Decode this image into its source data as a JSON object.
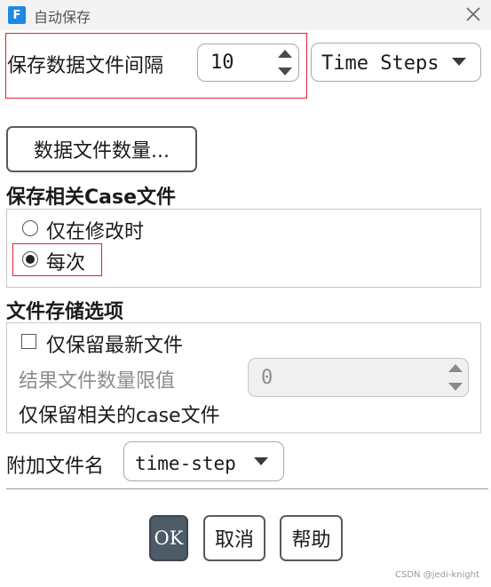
{
  "window": {
    "app_logo_letter": "F",
    "title": "自动保存"
  },
  "interval": {
    "label": "保存数据文件间隔",
    "value": "10",
    "unit_value": "Time Steps"
  },
  "data_file_count_button": "数据文件数量...",
  "case_group": {
    "label": "保存相关Case文件",
    "options": [
      {
        "label": "仅在修改时",
        "selected": false
      },
      {
        "label": "每次",
        "selected": true
      }
    ]
  },
  "storage_group": {
    "label": "文件存储选项",
    "keep_latest_label": "仅保留最新文件",
    "keep_latest_checked": false,
    "limit_label": "结果文件数量限值",
    "limit_value": "0",
    "keep_related_label": "仅保留相关的case文件"
  },
  "append": {
    "label": "附加文件名",
    "value": "time-step"
  },
  "buttons": {
    "ok": "OK",
    "cancel": "取消",
    "help": "帮助"
  },
  "watermark": "CSDN @jedi-knight"
}
